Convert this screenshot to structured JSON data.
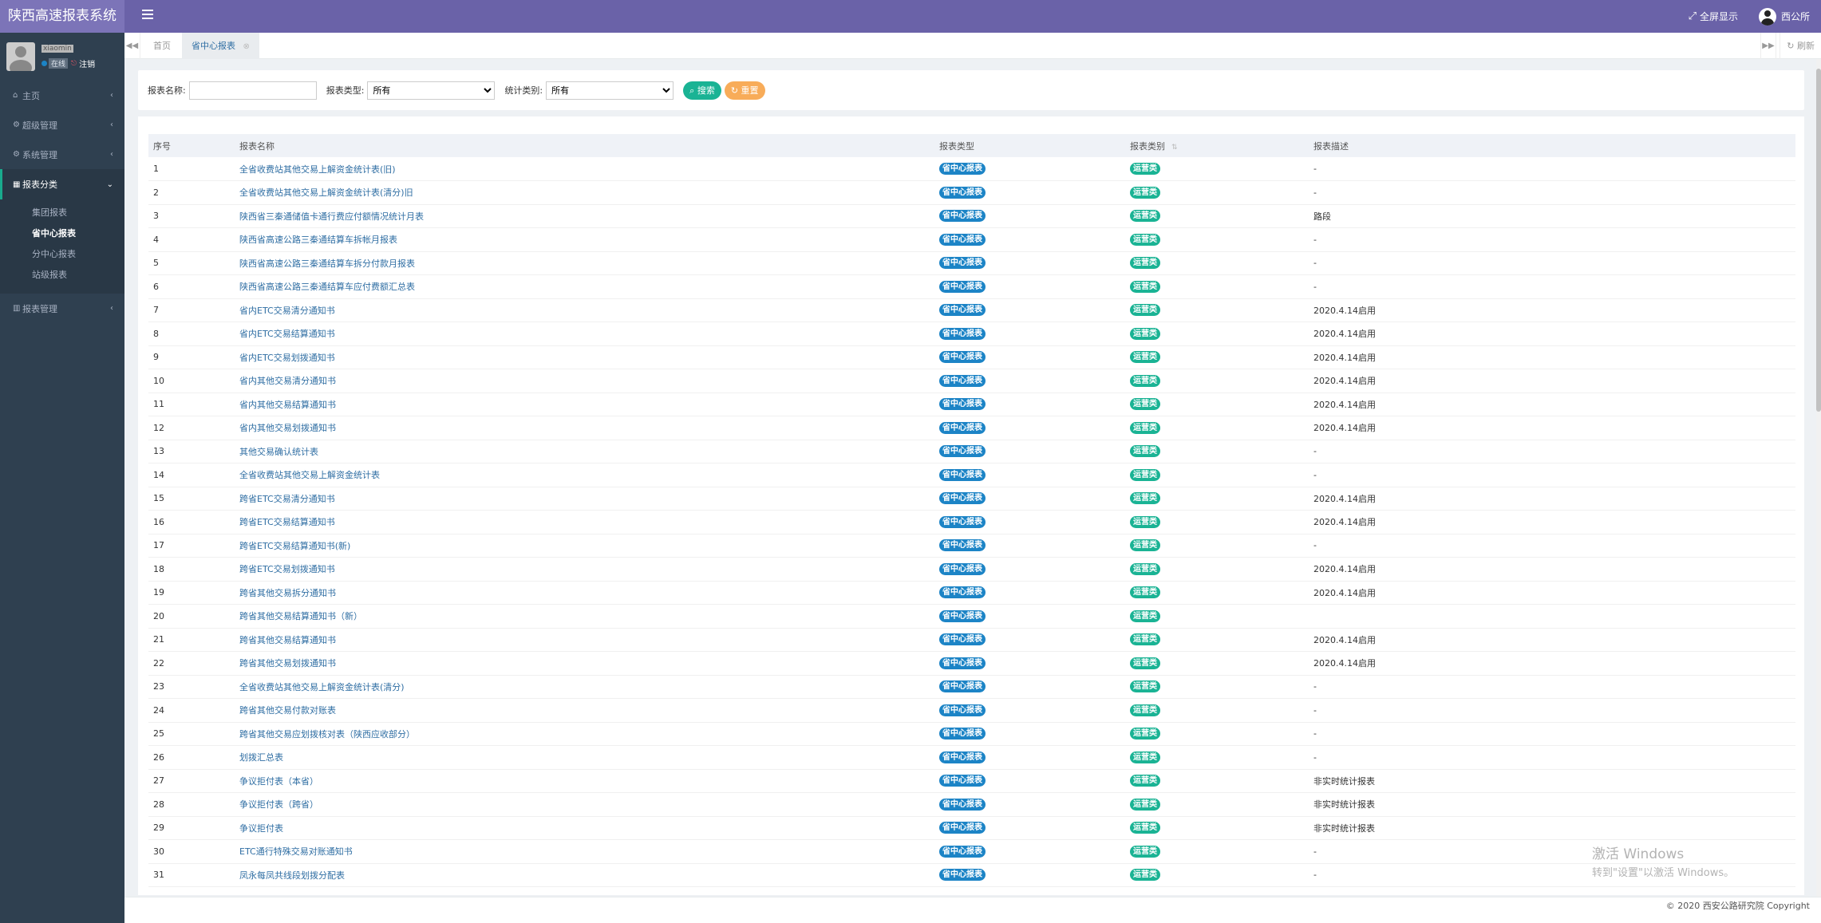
{
  "app": {
    "title": "陕西高速报表系统"
  },
  "topbar": {
    "fullscreen": "全屏显示",
    "user": "西公所",
    "fullscreen_icon": "expand-icon"
  },
  "sidebar": {
    "username": "xiaomin",
    "status": "在线",
    "logout": "注销",
    "menu": [
      {
        "label": "主页",
        "icon": "home-icon"
      },
      {
        "label": "超级管理",
        "icon": "gear-icon"
      },
      {
        "label": "系统管理",
        "icon": "gear-icon"
      },
      {
        "label": "报表分类",
        "icon": "table-icon"
      },
      {
        "label": "报表管理",
        "icon": "chart-icon"
      }
    ],
    "submenu": [
      "集团报表",
      "省中心报表",
      "分中心报表",
      "站级报表"
    ]
  },
  "tabs": {
    "home": "首页",
    "active": "省中心报表",
    "refresh": "刷新"
  },
  "search": {
    "name_label": "报表名称:",
    "name_value": "",
    "type_label": "报表类型:",
    "type_value": "所有",
    "category_label": "统计类别:",
    "category_value": "所有",
    "search_btn": "搜索",
    "reset_btn": "重置"
  },
  "table": {
    "headers": [
      "序号",
      "报表名称",
      "报表类型",
      "报表类别",
      "报表描述"
    ],
    "rows": [
      {
        "no": "1",
        "name": "全省收费站其他交易上解资金统计表(旧)",
        "type": "省中心报表",
        "cat": "运营类",
        "desc": "-"
      },
      {
        "no": "2",
        "name": "全省收费站其他交易上解资金统计表(清分)旧",
        "type": "省中心报表",
        "cat": "运营类",
        "desc": "-"
      },
      {
        "no": "3",
        "name": "陕西省三秦通储值卡通行费应付额情况统计月表",
        "type": "省中心报表",
        "cat": "运营类",
        "desc": "路段"
      },
      {
        "no": "4",
        "name": "陕西省高速公路三秦通结算车拆帐月报表",
        "type": "省中心报表",
        "cat": "运营类",
        "desc": "-"
      },
      {
        "no": "5",
        "name": "陕西省高速公路三秦通结算车拆分付款月报表",
        "type": "省中心报表",
        "cat": "运营类",
        "desc": "-"
      },
      {
        "no": "6",
        "name": "陕西省高速公路三秦通结算车应付费额汇总表",
        "type": "省中心报表",
        "cat": "运营类",
        "desc": "-"
      },
      {
        "no": "7",
        "name": "省内ETC交易清分通知书",
        "type": "省中心报表",
        "cat": "运营类",
        "desc": "2020.4.14启用"
      },
      {
        "no": "8",
        "name": "省内ETC交易结算通知书",
        "type": "省中心报表",
        "cat": "运营类",
        "desc": "2020.4.14启用"
      },
      {
        "no": "9",
        "name": "省内ETC交易划拨通知书",
        "type": "省中心报表",
        "cat": "运营类",
        "desc": "2020.4.14启用"
      },
      {
        "no": "10",
        "name": "省内其他交易清分通知书",
        "type": "省中心报表",
        "cat": "运营类",
        "desc": "2020.4.14启用"
      },
      {
        "no": "11",
        "name": "省内其他交易结算通知书",
        "type": "省中心报表",
        "cat": "运营类",
        "desc": "2020.4.14启用"
      },
      {
        "no": "12",
        "name": "省内其他交易划拨通知书",
        "type": "省中心报表",
        "cat": "运营类",
        "desc": "2020.4.14启用"
      },
      {
        "no": "13",
        "name": "其他交易确认统计表",
        "type": "省中心报表",
        "cat": "运营类",
        "desc": "-"
      },
      {
        "no": "14",
        "name": "全省收费站其他交易上解资金统计表",
        "type": "省中心报表",
        "cat": "运营类",
        "desc": "-"
      },
      {
        "no": "15",
        "name": "跨省ETC交易清分通知书",
        "type": "省中心报表",
        "cat": "运营类",
        "desc": "2020.4.14启用"
      },
      {
        "no": "16",
        "name": "跨省ETC交易结算通知书",
        "type": "省中心报表",
        "cat": "运营类",
        "desc": "2020.4.14启用"
      },
      {
        "no": "17",
        "name": "跨省ETC交易结算通知书(新)",
        "type": "省中心报表",
        "cat": "运营类",
        "desc": "-"
      },
      {
        "no": "18",
        "name": "跨省ETC交易划拨通知书",
        "type": "省中心报表",
        "cat": "运营类",
        "desc": "2020.4.14启用"
      },
      {
        "no": "19",
        "name": "跨省其他交易拆分通知书",
        "type": "省中心报表",
        "cat": "运营类",
        "desc": "2020.4.14启用"
      },
      {
        "no": "20",
        "name": "跨省其他交易结算通知书（新）",
        "type": "省中心报表",
        "cat": "运营类",
        "desc": ""
      },
      {
        "no": "21",
        "name": "跨省其他交易结算通知书",
        "type": "省中心报表",
        "cat": "运营类",
        "desc": "2020.4.14启用"
      },
      {
        "no": "22",
        "name": "跨省其他交易划拨通知书",
        "type": "省中心报表",
        "cat": "运营类",
        "desc": "2020.4.14启用"
      },
      {
        "no": "23",
        "name": "全省收费站其他交易上解资金统计表(清分)",
        "type": "省中心报表",
        "cat": "运营类",
        "desc": "-"
      },
      {
        "no": "24",
        "name": "跨省其他交易付款对账表",
        "type": "省中心报表",
        "cat": "运营类",
        "desc": "-"
      },
      {
        "no": "25",
        "name": "跨省其他交易应划拨核对表（陕西应收部分）",
        "type": "省中心报表",
        "cat": "运营类",
        "desc": "-"
      },
      {
        "no": "26",
        "name": "划拨汇总表",
        "type": "省中心报表",
        "cat": "运营类",
        "desc": "-"
      },
      {
        "no": "27",
        "name": "争议拒付表（本省）",
        "type": "省中心报表",
        "cat": "运营类",
        "desc": "非实时统计报表"
      },
      {
        "no": "28",
        "name": "争议拒付表（跨省）",
        "type": "省中心报表",
        "cat": "运营类",
        "desc": "非实时统计报表"
      },
      {
        "no": "29",
        "name": "争议拒付表",
        "type": "省中心报表",
        "cat": "运营类",
        "desc": "非实时统计报表"
      },
      {
        "no": "30",
        "name": "ETC通行特殊交易对账通知书",
        "type": "省中心报表",
        "cat": "运营类",
        "desc": "-"
      },
      {
        "no": "31",
        "name": "凤永每凤共线段划拨分配表",
        "type": "省中心报表",
        "cat": "运营类",
        "desc": "-"
      }
    ]
  },
  "footer": {
    "copyright": "© 2020 西安公路研究院 Copyright"
  },
  "watermark": {
    "line1": "激活 Windows",
    "line2": "转到\"设置\"以激活 Windows。"
  }
}
